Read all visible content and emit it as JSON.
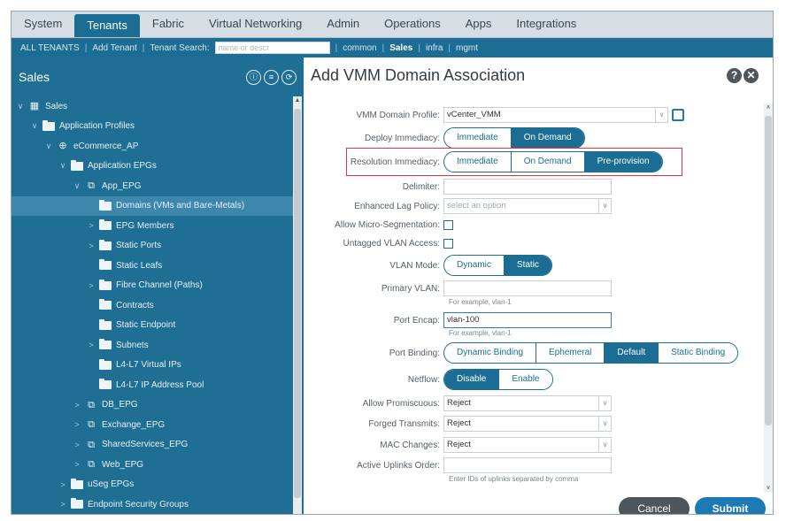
{
  "topnav": {
    "tabs": [
      "System",
      "Tenants",
      "Fabric",
      "Virtual Networking",
      "Admin",
      "Operations",
      "Apps",
      "Integrations"
    ],
    "active": "Tenants"
  },
  "subnav": {
    "all_tenants": "ALL TENANTS",
    "add_tenant": "Add Tenant",
    "tenant_search_label": "Tenant Search:",
    "search_placeholder": "name or descr",
    "tenants": [
      "common",
      "Sales",
      "infra",
      "mgmt"
    ],
    "active_tenant": "Sales"
  },
  "sidebar": {
    "title": "Sales",
    "tree": [
      {
        "label": "Sales",
        "indent": 0,
        "chev": "∨",
        "icon": "grid"
      },
      {
        "label": "Application Profiles",
        "indent": 1,
        "chev": "∨",
        "icon": "folder"
      },
      {
        "label": "eCommerce_AP",
        "indent": 2,
        "chev": "∨",
        "icon": "app"
      },
      {
        "label": "Application EPGs",
        "indent": 3,
        "chev": "∨",
        "icon": "folder"
      },
      {
        "label": "App_EPG",
        "indent": 4,
        "chev": "∨",
        "icon": "epg"
      },
      {
        "label": "Domains (VMs and Bare-Metals)",
        "indent": 5,
        "chev": "",
        "icon": "folder",
        "selected": true
      },
      {
        "label": "EPG Members",
        "indent": 5,
        "chev": ">",
        "icon": "folder"
      },
      {
        "label": "Static Ports",
        "indent": 5,
        "chev": ">",
        "icon": "folder"
      },
      {
        "label": "Static Leafs",
        "indent": 5,
        "chev": "",
        "icon": "folder"
      },
      {
        "label": "Fibre Channel (Paths)",
        "indent": 5,
        "chev": ">",
        "icon": "folder"
      },
      {
        "label": "Contracts",
        "indent": 5,
        "chev": "",
        "icon": "folder"
      },
      {
        "label": "Static Endpoint",
        "indent": 5,
        "chev": "",
        "icon": "folder"
      },
      {
        "label": "Subnets",
        "indent": 5,
        "chev": ">",
        "icon": "folder"
      },
      {
        "label": "L4-L7 Virtual IPs",
        "indent": 5,
        "chev": "",
        "icon": "folder"
      },
      {
        "label": "L4-L7 IP Address Pool",
        "indent": 5,
        "chev": "",
        "icon": "folder"
      },
      {
        "label": "DB_EPG",
        "indent": 4,
        "chev": ">",
        "icon": "epg"
      },
      {
        "label": "Exchange_EPG",
        "indent": 4,
        "chev": ">",
        "icon": "epg"
      },
      {
        "label": "SharedServices_EPG",
        "indent": 4,
        "chev": ">",
        "icon": "epg"
      },
      {
        "label": "Web_EPG",
        "indent": 4,
        "chev": ">",
        "icon": "epg"
      },
      {
        "label": "uSeg EPGs",
        "indent": 3,
        "chev": ">",
        "icon": "folder"
      },
      {
        "label": "Endpoint Security Groups",
        "indent": 3,
        "chev": ">",
        "icon": "folder"
      }
    ]
  },
  "panel": {
    "title": "Add VMM Domain Association",
    "fields": {
      "vmm_domain_profile": {
        "label": "VMM Domain Profile:",
        "value": "vCenter_VMM"
      },
      "deploy_immediacy": {
        "label": "Deploy Immediacy:",
        "options": [
          "Immediate",
          "On Demand"
        ],
        "selected": "On Demand"
      },
      "resolution_immediacy": {
        "label": "Resolution Immediacy:",
        "options": [
          "Immediate",
          "On Demand",
          "Pre-provision"
        ],
        "selected": "Pre-provision"
      },
      "delimiter": {
        "label": "Delimiter:",
        "value": ""
      },
      "enhanced_lag_policy": {
        "label": "Enhanced Lag Policy:",
        "placeholder": "select an option"
      },
      "allow_micro_segmentation": {
        "label": "Allow Micro-Segmentation:"
      },
      "untagged_vlan_access": {
        "label": "Untagged VLAN Access:"
      },
      "vlan_mode": {
        "label": "VLAN Mode:",
        "options": [
          "Dynamic",
          "Static"
        ],
        "selected": "Static"
      },
      "primary_vlan": {
        "label": "Primary VLAN:",
        "value": "",
        "hint": "For example, vlan-1"
      },
      "port_encap": {
        "label": "Port Encap:",
        "value": "vlan-100",
        "hint": "For example, vlan-1"
      },
      "port_binding": {
        "label": "Port Binding:",
        "options": [
          "Dynamic Binding",
          "Ephemeral",
          "Default",
          "Static Binding"
        ],
        "selected": "Default"
      },
      "netflow": {
        "label": "Netflow:",
        "options": [
          "Disable",
          "Enable"
        ],
        "selected": "Disable"
      },
      "allow_promiscuous": {
        "label": "Allow Promiscuous:",
        "value": "Reject"
      },
      "forged_transmits": {
        "label": "Forged Transmits:",
        "value": "Reject"
      },
      "mac_changes": {
        "label": "MAC Changes:",
        "value": "Reject"
      },
      "active_uplinks_order": {
        "label": "Active Uplinks Order:",
        "value": "",
        "hint": "Enter IDs of uplinks separated by comma"
      }
    },
    "cancel_label": "Cancel",
    "submit_label": "Submit"
  },
  "colors": {
    "brand": "#1b6d93",
    "highlight": "#e8333a",
    "submit": "#1b7ab3"
  }
}
